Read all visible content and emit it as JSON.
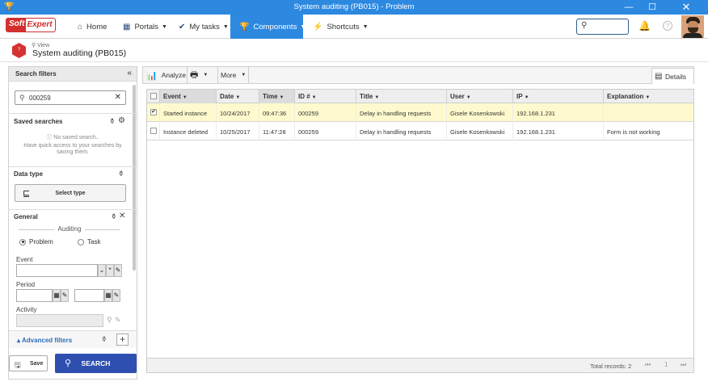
{
  "window": {
    "title": "System auditing (PB015) - Problem",
    "minimize": "—",
    "maximize": "☐",
    "close": "✕"
  },
  "navbar": {
    "logo_part1": "Soft",
    "logo_part2": "Expert",
    "items": [
      {
        "label": "Home",
        "icon": "home-icon"
      },
      {
        "label": "Portals",
        "icon": "grid-icon"
      },
      {
        "label": "My tasks",
        "icon": "check-icon"
      },
      {
        "label": "Components",
        "icon": "trophy-icon",
        "active": true
      },
      {
        "label": "Shortcuts",
        "icon": "bolt-icon"
      }
    ],
    "search_placeholder": "",
    "help": "?"
  },
  "page": {
    "view_label": "View",
    "title": "System auditing (PB015)"
  },
  "filters": {
    "header": "Search filters",
    "search_value": "000259",
    "saved_searches": {
      "title": "Saved searches",
      "empty_title": "No saved search..",
      "empty_hint_line1": "Have quick access to your searches by",
      "empty_hint_line2": "saving them."
    },
    "data_type": {
      "title": "Data type",
      "select_label": "Select type"
    },
    "general": {
      "title": "General",
      "auditing_label": "Auditing",
      "options": [
        {
          "label": "Problem",
          "selected": true
        },
        {
          "label": "Task",
          "selected": false
        }
      ],
      "event_label": "Event",
      "period_label": "Period",
      "activity_label": "Activity"
    },
    "advanced_label": "Advanced filters",
    "save_label": "Save",
    "search_label": "SEARCH"
  },
  "toolbar": {
    "analyze_label": "Analyze",
    "more_label": "More",
    "details_label": "Details"
  },
  "grid": {
    "columns": [
      "Event",
      "Date",
      "Time",
      "ID #",
      "Title",
      "User",
      "IP",
      "Explanation"
    ],
    "rows": [
      {
        "checked": true,
        "event": "Started instance",
        "date": "10/24/2017",
        "time": "09:47:36",
        "id": "000259",
        "title": "Delay in handling requests",
        "user": "Gisele Kosenkowski",
        "ip": "192.168.1.231",
        "explanation": ""
      },
      {
        "checked": false,
        "event": "Instance deleted",
        "date": "10/25/2017",
        "time": "11:47:28",
        "id": "000259",
        "title": "Delay in handling requests",
        "user": "Gisele Kosenkowski",
        "ip": "192.168.1.231",
        "explanation": "Form is not working"
      }
    ],
    "total_label": "Total records: 2",
    "page": "1"
  },
  "colors": {
    "accent": "#2d89e0",
    "search_button": "#2f4fb0",
    "selected_row": "#fffacd",
    "brand_red": "#d32f2f"
  }
}
